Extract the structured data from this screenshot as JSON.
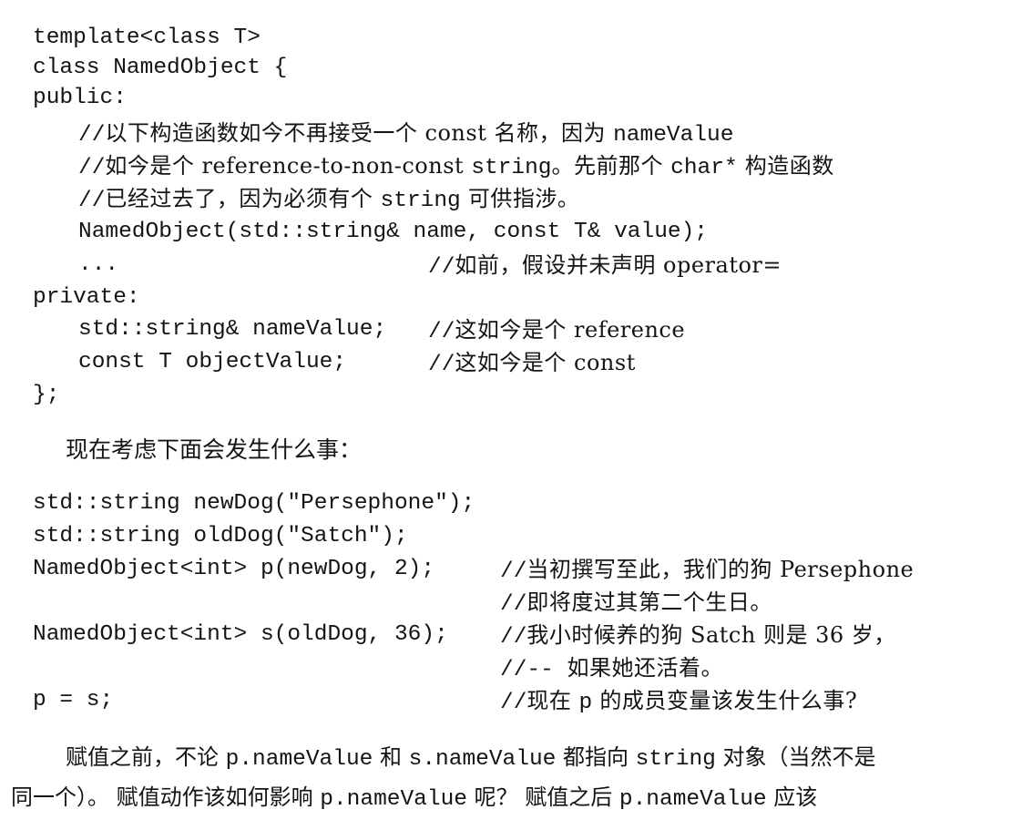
{
  "code_block_1": {
    "lines": [
      "template<class T>",
      "class NamedObject {",
      "public:",
      "//",
      "以下构造函数如今不再接受一个 const 名称，因为 ",
      "nameValue",
      "//",
      "如今是个 reference-to-non-const ",
      "string",
      "。先前那个 ",
      "char*",
      " 构造函数",
      "//",
      "已经过去了，因为必须有个 ",
      "string",
      " 可供指涉。",
      "NamedObject(std::string& name, const T& value);",
      "...",
      "//",
      "如前，假设并未声明 operator=",
      "private:",
      "std::string& nameValue;",
      "//",
      "这如今是个 reference",
      "const T objectValue;",
      "//",
      "这如今是个 const",
      "};"
    ]
  },
  "intro_text": "现在考虑下面会发生什么事：",
  "code_block_2": {
    "lines": [
      "std::string newDog(\"Persephone\");",
      "std::string oldDog(\"Satch\");",
      "NamedObject<int> p(newDog, 2);",
      "//",
      "当初撰写至此，我们的狗 Persephone",
      "//",
      "即将度过其第二个生日。",
      "NamedObject<int> s(oldDog, 36);",
      "//",
      "我小时候养的狗 Satch 则是 36 岁，",
      "//-- ",
      "如果她还活着。",
      "p = s;",
      "//",
      "现在 ",
      "p",
      " 的成员变量该发生什么事?"
    ]
  },
  "paragraph": {
    "parts": [
      "赋值之前，不论 ",
      "p.nameValue",
      " 和 ",
      "s.nameValue",
      " 都指向 ",
      "string",
      " 对象（当然不是",
      "同一个）。 赋值动作该如何影响 ",
      "p.nameValue",
      " 呢？ 赋值之后 ",
      "p.nameValue",
      " 应该"
    ]
  }
}
